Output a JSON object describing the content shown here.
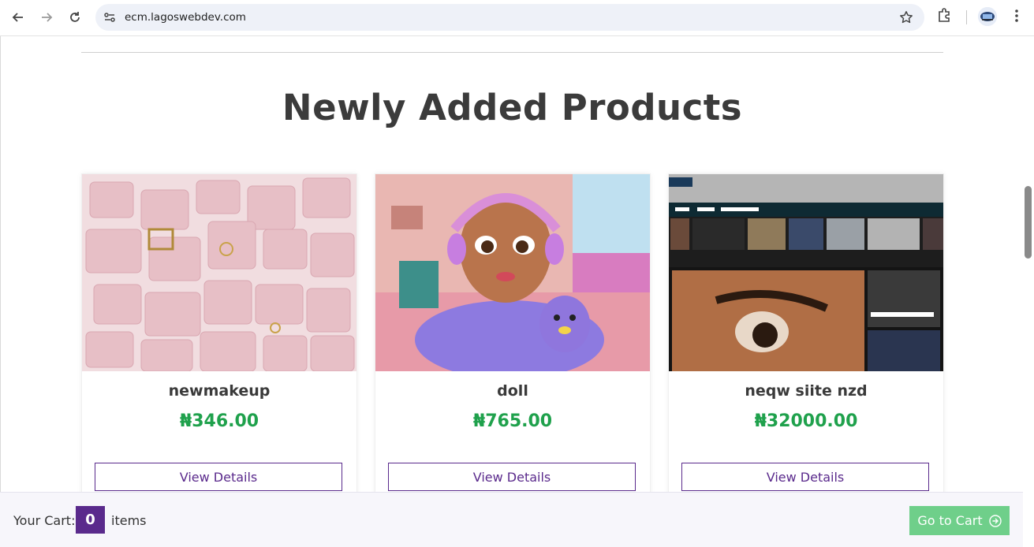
{
  "browser": {
    "url": "ecm.lagoswebdev.com"
  },
  "section": {
    "title": "Newly Added Products"
  },
  "products": [
    {
      "name": "newmakeup",
      "price": "₦346.00",
      "button": "View Details",
      "image": "pink-handbags-image"
    },
    {
      "name": "doll",
      "price": "₦765.00",
      "button": "View Details",
      "image": "cartoon-girl-headphones-image"
    },
    {
      "name": "neqw siite nzd",
      "price": "₦32000.00",
      "button": "View Details",
      "image": "movie-website-screenshot-image"
    }
  ],
  "cart": {
    "label": "Your Cart:",
    "count": "0",
    "items_label": "items",
    "go_label": "Go to Cart"
  },
  "colors": {
    "accent_purple": "#5a2a8c",
    "price_green": "#1fa14c",
    "go_cart_green": "#6fcf8a"
  }
}
